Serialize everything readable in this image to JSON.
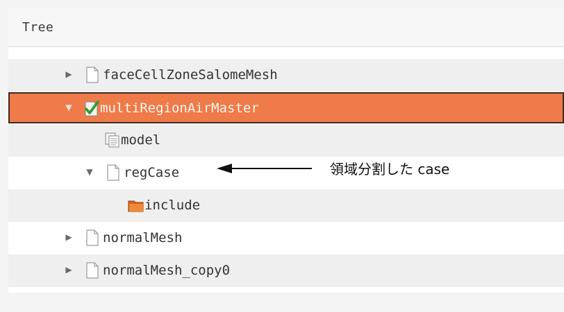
{
  "header": {
    "title": "Tree"
  },
  "tree": {
    "rows": [
      {
        "label": "faceCellZoneSalomeMesh",
        "icon": "file-icon",
        "expand": "collapsed"
      },
      {
        "label": "multiRegionAirMaster",
        "icon": "checked-file-icon",
        "expand": "expanded",
        "selected": true
      },
      {
        "label": "model",
        "icon": "model-doc-icon",
        "expand": "none"
      },
      {
        "label": "regCase",
        "icon": "file-icon",
        "expand": "expanded"
      },
      {
        "label": "include",
        "icon": "folder-icon",
        "expand": "none"
      },
      {
        "label": "normalMesh",
        "icon": "file-icon",
        "expand": "collapsed"
      },
      {
        "label": "normalMesh_copy0",
        "icon": "file-icon",
        "expand": "collapsed"
      }
    ]
  },
  "annotation": {
    "text": "領域分割した case"
  },
  "colors": {
    "selection": "#ee7b49",
    "selection_border": "#3b2a22",
    "row_alt": "#efefef"
  },
  "icons": {
    "expand_collapsed": "▶",
    "expand_expanded": "▼"
  }
}
